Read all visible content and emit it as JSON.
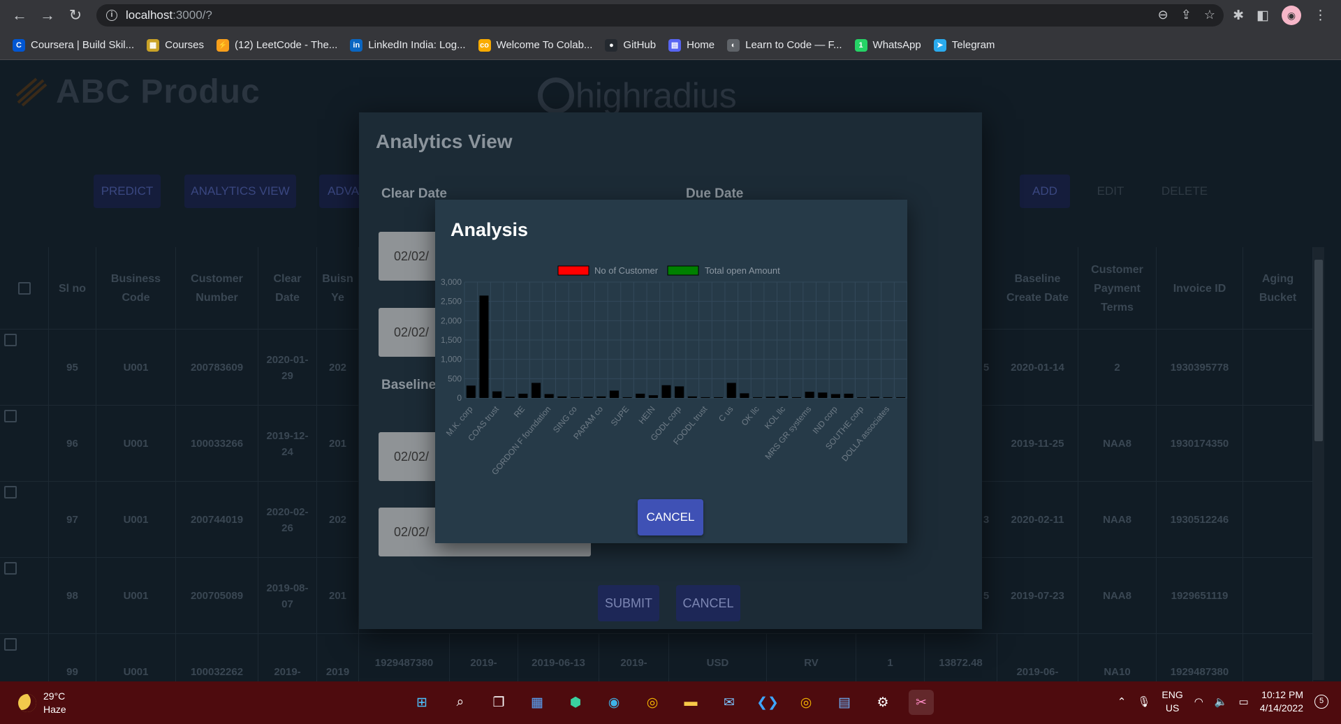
{
  "browser": {
    "url_host": "localhost",
    "url_rest": ":3000/?",
    "bookmarks": [
      {
        "label": "Coursera | Build Skil...",
        "icon": "coursera-icon",
        "color": "#0056d2",
        "glyph": "C"
      },
      {
        "label": "Courses",
        "icon": "courses-icon",
        "color": "#c9a227",
        "glyph": "▦"
      },
      {
        "label": "(12) LeetCode - The...",
        "icon": "leetcode-icon",
        "color": "#f89f1b",
        "glyph": "⚡"
      },
      {
        "label": "LinkedIn India: Log...",
        "icon": "linkedin-icon",
        "color": "#0a66c2",
        "glyph": "in"
      },
      {
        "label": "Welcome To Colab...",
        "icon": "colab-icon",
        "color": "#f9ab00",
        "glyph": "co"
      },
      {
        "label": "GitHub",
        "icon": "github-icon",
        "color": "#24292f",
        "glyph": "●"
      },
      {
        "label": "Home",
        "icon": "home-icon",
        "color": "#5865f2",
        "glyph": "▤"
      },
      {
        "label": "Learn to Code — F...",
        "icon": "freecodecamp-icon",
        "color": "#5f6368",
        "glyph": "◐"
      },
      {
        "label": "WhatsApp",
        "icon": "whatsapp-icon",
        "color": "#25d366",
        "glyph": "1"
      },
      {
        "label": "Telegram",
        "icon": "telegram-icon",
        "color": "#2aabee",
        "glyph": "➤"
      }
    ]
  },
  "app": {
    "brand_abc": "ABC Produc",
    "brand_hr": "highradius",
    "toolbar": {
      "predict": "PREDICT",
      "analytics_view": "ANALYTICS VIEW",
      "advanced": "ADVA",
      "add": "ADD",
      "edit": "EDIT",
      "delete": "DELETE"
    },
    "columns": {
      "sl_no": "Sl no",
      "business_code": "Business Code",
      "customer_number": "Customer Number",
      "clear_date": "Clear Date",
      "business_year": "Buisn Ye",
      "baseline_create_date": "Baseline Create Date",
      "customer_payment_terms": "Customer Payment Terms",
      "invoice_id": "Invoice ID",
      "aging_bucket": "Aging Bucket"
    },
    "rows": [
      {
        "sl": "95",
        "code": "U001",
        "cust": "200783609",
        "clear": "2020-01-29",
        "year": "202",
        "tail": "5",
        "base": "2020-01-14",
        "terms": "2",
        "inv": "1930395778"
      },
      {
        "sl": "96",
        "code": "U001",
        "cust": "100033266",
        "clear": "2019-12-24",
        "year": "201",
        "tail": "",
        "base": "2019-11-25",
        "terms": "NAA8",
        "inv": "1930174350"
      },
      {
        "sl": "97",
        "code": "U001",
        "cust": "200744019",
        "clear": "2020-02-26",
        "year": "202",
        "tail": "3",
        "base": "2020-02-11",
        "terms": "NAA8",
        "inv": "1930512246"
      },
      {
        "sl": "98",
        "code": "U001",
        "cust": "200705089",
        "clear": "2019-08-07",
        "year": "201",
        "tail": "5",
        "base": "2019-07-23",
        "terms": "NAA8",
        "inv": "1929651119"
      },
      {
        "sl": "99",
        "code": "U001",
        "cust": "100032262",
        "clear": "2019-",
        "year": "2019",
        "c6": "1929487380",
        "c7": "2019-",
        "c8": "2019-06-13",
        "c9": "2019-",
        "c10": "USD",
        "c11": "RV",
        "c12": "1",
        "c13": "13872.48",
        "base": "2019-06-",
        "terms": "NA10",
        "inv": "1929487380"
      }
    ]
  },
  "analytics_view": {
    "title": "Analytics View",
    "clear_date_label": "Clear Date",
    "due_date_label": "Due Date",
    "baseline_label": "Baseline",
    "date_value": "02/02/",
    "submit": "SUBMIT",
    "cancel": "CANCEL"
  },
  "analysis": {
    "title": "Analysis",
    "cancel": "CANCEL"
  },
  "chart_data": {
    "type": "bar",
    "legend_position": "top",
    "grid": true,
    "ylim": [
      0,
      3000
    ],
    "yticks": [
      "0",
      "500",
      "1,000",
      "1,500",
      "2,000",
      "2,500",
      "3,000"
    ],
    "categories": [
      "M.K. corp",
      "",
      "COAS trust",
      "",
      "RE",
      "",
      "GORDON F foundation",
      "",
      "SING co",
      "",
      "PARAM co",
      "",
      "SUPE",
      "",
      "HEIN",
      "",
      "GODL corp",
      "",
      "FOODL trust",
      "",
      "C us",
      "",
      "OK llc",
      "",
      "KOL llc",
      "",
      "MRS GR systems",
      "",
      "IND corp",
      "",
      "SOUTHE corp",
      "",
      "DOLLA associates",
      ""
    ],
    "series": [
      {
        "name": "No of Customer",
        "color": "#ff0000",
        "values": [
          0,
          0,
          0,
          0,
          0,
          0,
          0,
          0,
          0,
          0,
          0,
          0,
          0,
          0,
          0,
          0,
          0,
          0,
          0,
          0,
          0,
          0,
          0,
          0,
          0,
          0,
          0,
          0,
          0,
          0,
          0,
          0,
          0,
          0
        ]
      },
      {
        "name": "Total open Amount",
        "color": "#008000",
        "values": [
          320,
          2650,
          170,
          30,
          110,
          390,
          100,
          40,
          20,
          30,
          40,
          190,
          20,
          110,
          70,
          330,
          300,
          40,
          20,
          20,
          390,
          120,
          20,
          30,
          50,
          20,
          160,
          140,
          100,
          110,
          20,
          30,
          20,
          20
        ]
      }
    ],
    "bar_color": "#000000"
  },
  "taskbar": {
    "temp": "29°C",
    "cond": "Haze",
    "lang1": "ENG",
    "lang2": "US",
    "time": "10:12 PM",
    "date": "4/14/2022",
    "notif": "5"
  }
}
